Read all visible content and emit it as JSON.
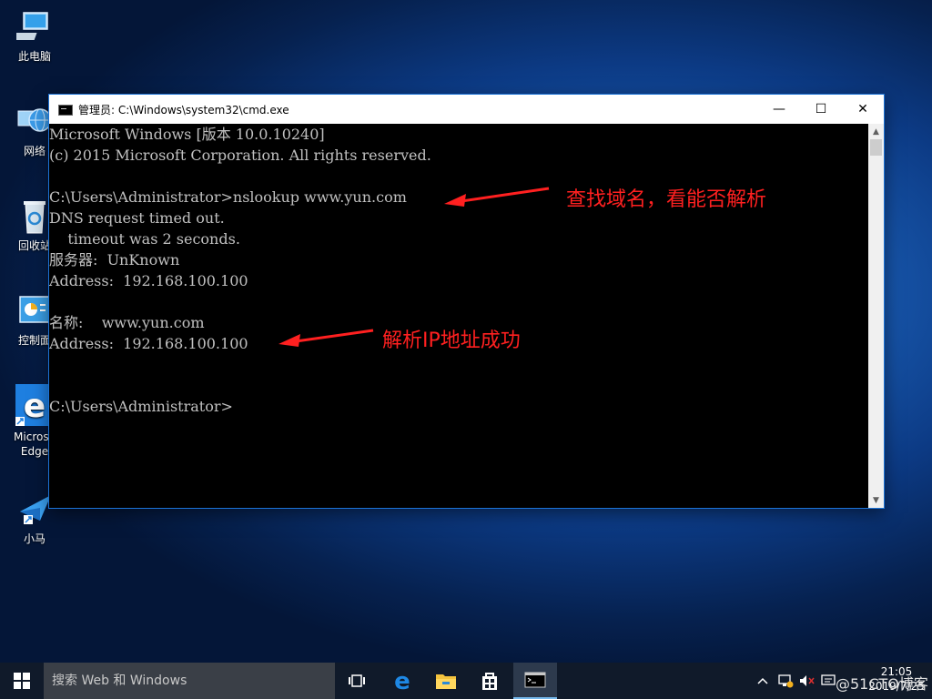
{
  "desktop": {
    "icons": [
      {
        "label": "此电脑"
      },
      {
        "label": "网络"
      },
      {
        "label": "回收站"
      },
      {
        "label": "控制面"
      },
      {
        "label": "Microso",
        "label2": "Edge"
      },
      {
        "label": "小马"
      }
    ]
  },
  "window": {
    "title": "管理员: C:\\Windows\\system32\\cmd.exe",
    "minimize": "—",
    "maximize": "☐",
    "close": "✕"
  },
  "console": {
    "lines": [
      "Microsoft Windows [版本 10.0.10240]",
      "(c) 2015 Microsoft Corporation. All rights reserved.",
      "",
      "C:\\Users\\Administrator>nslookup www.yun.com",
      "DNS request timed out.",
      "    timeout was 2 seconds.",
      "服务器:  UnKnown",
      "Address:  192.168.100.100",
      "",
      "名称:    www.yun.com",
      "Address:  192.168.100.100",
      "",
      "",
      "C:\\Users\\Administrator>"
    ]
  },
  "annotations": {
    "a1": "查找域名，看能否解析",
    "a2": "解析IP地址成功",
    "color": "#ff2020"
  },
  "taskbar": {
    "search_placeholder": "搜索 Web 和 Windows",
    "clock_time": "21:05",
    "clock_date": "2019/7/25",
    "watermark": "@51CTO博客"
  }
}
